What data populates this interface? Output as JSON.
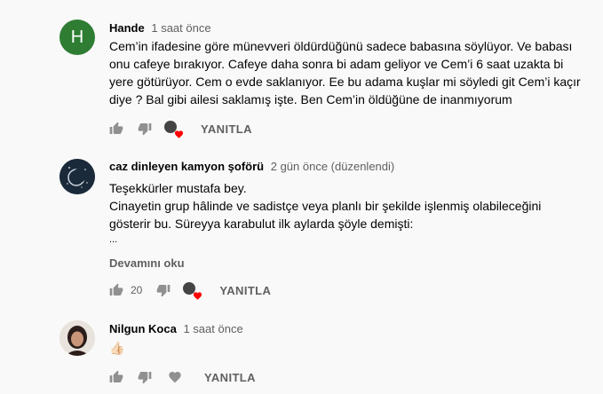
{
  "comments": [
    {
      "author": "Hande",
      "time": "1 saat önce",
      "avatar_letter": "H",
      "text_lines": [
        "Cem’in ifadesine göre münevveri öldürdüğünü sadece babasına söylüyor. Ve babası",
        "onu cafeye bırakıyor. Cafeye daha sonra bi adam geliyor ve Cem’i 6 saat uzakta bi",
        "yere götürüyor. Cem o evde saklanıyor. Ee bu adama kuşlar mi söyledi git Cem’i kaçır",
        "diye ? Bal gibi ailesi saklamış işte. Ben Cem’in öldüğüne de inanmıyorum"
      ],
      "reply_label": "YANITLA"
    },
    {
      "author": "caz dinleyen kamyon şoförü",
      "time": "2 gün önce (düzenlendi)",
      "text_lines": [
        "Teşekkürler mustafa bey.",
        "Cinayetin grup hâlinde ve sadistçe veya planlı bir şekilde işlenmiş olabileceğini",
        "gösterir bu. Süreyya karabulut ilk aylarda şöyle demişti:",
        "..."
      ],
      "more_label": "Devamını oku",
      "like_count": "20",
      "reply_label": "YANITLA"
    },
    {
      "author": "Nilgun Koca",
      "time": "1 saat önce",
      "text_lines": [
        "👍🏻"
      ],
      "reply_label": "YANITLA"
    }
  ],
  "colors": {
    "heart": "#ff0000",
    "avatar_h": "#2e7d32",
    "secondary_text": "#606060"
  }
}
